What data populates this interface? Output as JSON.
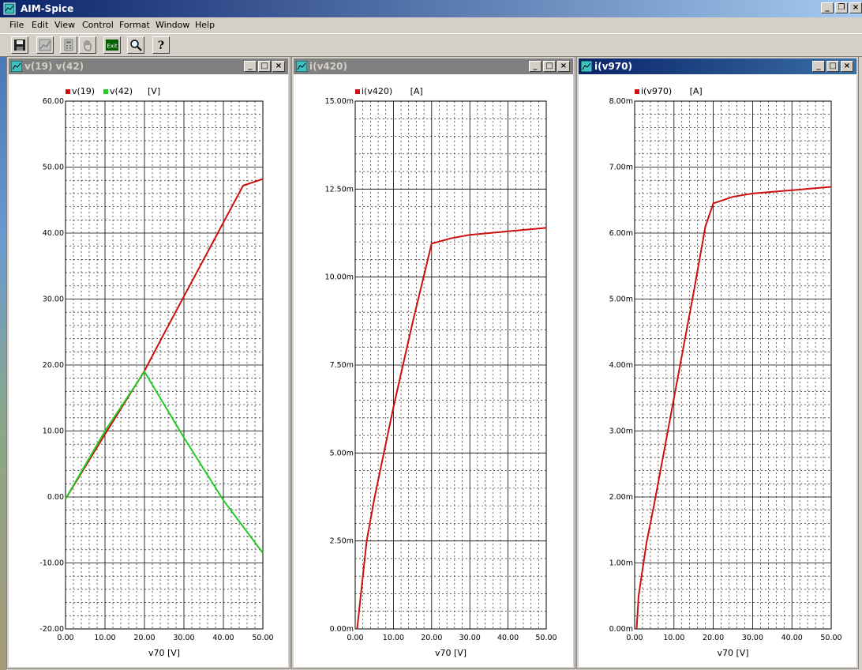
{
  "app": {
    "title": "AIM-Spice"
  },
  "menu": [
    "File",
    "Edit",
    "View",
    "Control",
    "Format",
    "Window",
    "Help"
  ],
  "toolbar": {
    "buttons": [
      {
        "name": "save-button",
        "icon": "floppy-disk-icon"
      },
      {
        "name": "plot-button",
        "icon": "plot-icon"
      },
      {
        "name": "calc-button",
        "icon": "calculator-icon"
      },
      {
        "name": "pan-button",
        "icon": "hand-icon"
      },
      {
        "name": "exit-button",
        "icon": "exit-icon",
        "label": "Exit"
      },
      {
        "name": "zoom-button",
        "icon": "magnifier-icon"
      },
      {
        "name": "help-button",
        "icon": "help-icon"
      }
    ]
  },
  "windows": [
    {
      "title": "v(19) v(42)",
      "active": false,
      "chart_data": {
        "type": "line",
        "legend": [
          "v(19)",
          "v(42)"
        ],
        "unit": "[V]",
        "xlabel": "v70 [V]",
        "xlim": [
          0,
          50
        ],
        "ylim": [
          -20,
          60
        ],
        "xticks": [
          "0.00",
          "10.00",
          "20.00",
          "30.00",
          "40.00",
          "50.00"
        ],
        "yticks": [
          "-20.00",
          "-10.00",
          "0.00",
          "10.00",
          "20.00",
          "30.00",
          "40.00",
          "50.00",
          "60.00"
        ],
        "grid": true,
        "series": [
          {
            "name": "v(19)",
            "color": "#cc1010",
            "x": [
              0,
              5,
              10,
              15,
              20,
              25,
              30,
              35,
              40,
              45,
              50
            ],
            "y": [
              -0.3,
              4.6,
              9.5,
              14.3,
              19.1,
              24.8,
              30.4,
              36.0,
              41.6,
              47.2,
              48.2
            ]
          },
          {
            "name": "v(42)",
            "color": "#22cc22",
            "x": [
              0,
              10,
              20,
              30,
              40,
              50
            ],
            "y": [
              -0.3,
              10.0,
              19.0,
              9.0,
              -0.5,
              -8.5
            ]
          }
        ]
      }
    },
    {
      "title": "i(v420)",
      "active": false,
      "chart_data": {
        "type": "line",
        "legend": [
          "i(v420)"
        ],
        "unit": "[A]",
        "xlabel": "v70 [V]",
        "xlim": [
          0,
          50
        ],
        "ylim": [
          0,
          15
        ],
        "xticks": [
          "0.00",
          "10.00",
          "20.00",
          "30.00",
          "40.00",
          "50.00"
        ],
        "yticks": [
          "0.00m",
          "2.50m",
          "5.00m",
          "7.50m",
          "10.00m",
          "12.50m",
          "15.00m"
        ],
        "grid": true,
        "series": [
          {
            "name": "i(v420)",
            "color": "#cc1010",
            "x": [
              0.5,
              1,
              3,
              5,
              10,
              15,
              20,
              25,
              30,
              40,
              50
            ],
            "y": [
              0,
              0.5,
              2.5,
              3.7,
              6.3,
              8.7,
              10.95,
              11.1,
              11.2,
              11.3,
              11.4
            ]
          }
        ]
      }
    },
    {
      "title": "i(v970)",
      "active": true,
      "chart_data": {
        "type": "line",
        "legend": [
          "i(v970)"
        ],
        "unit": "[A]",
        "xlabel": "v70 [V]",
        "xlim": [
          0,
          50
        ],
        "ylim": [
          0,
          8
        ],
        "xticks": [
          "0.00",
          "10.00",
          "20.00",
          "30.00",
          "40.00",
          "50.00"
        ],
        "yticks": [
          "0.00m",
          "1.00m",
          "2.00m",
          "3.00m",
          "4.00m",
          "5.00m",
          "6.00m",
          "7.00m",
          "8.00m"
        ],
        "grid": true,
        "series": [
          {
            "name": "i(v970)",
            "color": "#cc1010",
            "x": [
              0.5,
              1,
              3,
              5,
              10,
              15,
              18,
              20,
              25,
              30,
              40,
              50
            ],
            "y": [
              0,
              0.5,
              1.3,
              1.9,
              3.5,
              5.1,
              6.1,
              6.45,
              6.55,
              6.6,
              6.65,
              6.7
            ]
          }
        ]
      }
    }
  ]
}
